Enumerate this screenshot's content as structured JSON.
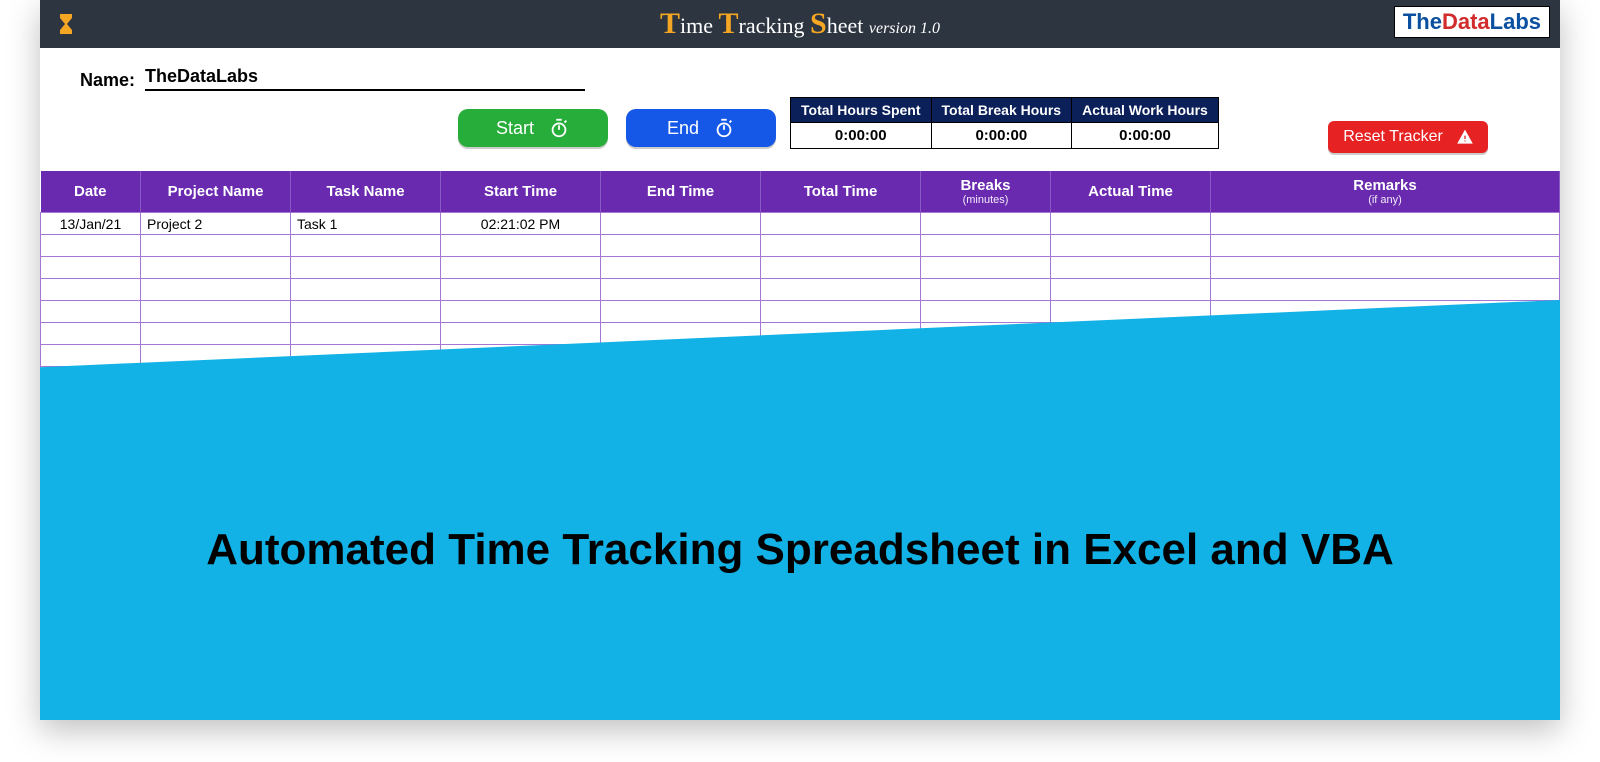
{
  "header": {
    "title_parts": {
      "t": "T",
      "ime": "ime ",
      "t2": "T",
      "racking": "racking ",
      "s": "S",
      "heet": "heet ",
      "ver": "version 1.0"
    },
    "logo": {
      "p1": "The",
      "p2": "Data",
      "p3": "Labs"
    }
  },
  "name": {
    "label": "Name:",
    "value": "TheDataLabs"
  },
  "buttons": {
    "start": "Start",
    "end": "End",
    "reset": "Reset Tracker"
  },
  "summary": {
    "headers": [
      "Total Hours Spent",
      "Total Break Hours",
      "Actual Work Hours"
    ],
    "values": [
      "0:00:00",
      "0:00:00",
      "0:00:00"
    ]
  },
  "grid": {
    "columns": [
      {
        "label": "Date"
      },
      {
        "label": "Project Name"
      },
      {
        "label": "Task Name"
      },
      {
        "label": "Start Time"
      },
      {
        "label": "End Time"
      },
      {
        "label": "Total Time"
      },
      {
        "label": "Breaks",
        "sub": "(minutes)"
      },
      {
        "label": "Actual Time"
      },
      {
        "label": "Remarks",
        "sub": "(if any)"
      }
    ],
    "rows": [
      {
        "date": "13/Jan/21",
        "project": "Project 2",
        "task": "Task 1",
        "start": "02:21:02 PM",
        "end": "",
        "total": "",
        "breaks": "",
        "actual": "",
        "remarks": ""
      }
    ],
    "empty_rows": 8
  },
  "overlay": {
    "caption": "Automated Time Tracking Spreadsheet in Excel and VBA"
  }
}
